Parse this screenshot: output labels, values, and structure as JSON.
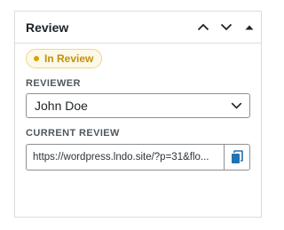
{
  "panel": {
    "title": "Review",
    "move_up_icon": "chevron-up-icon",
    "move_down_icon": "chevron-down-icon",
    "toggle_icon": "triangle-up-icon"
  },
  "status_badge": {
    "label": "In Review",
    "color": "#c4900b",
    "background": "#fcf9e8"
  },
  "reviewer": {
    "label": "REVIEWER",
    "selected": "John Doe",
    "icon": "chevron-down-icon"
  },
  "current_review": {
    "label": "CURRENT REVIEW",
    "url_display": "https://wordpress.lndo.site/?p=31&flo...",
    "copy_icon": "copy-icon",
    "accent": "#2271b1"
  }
}
